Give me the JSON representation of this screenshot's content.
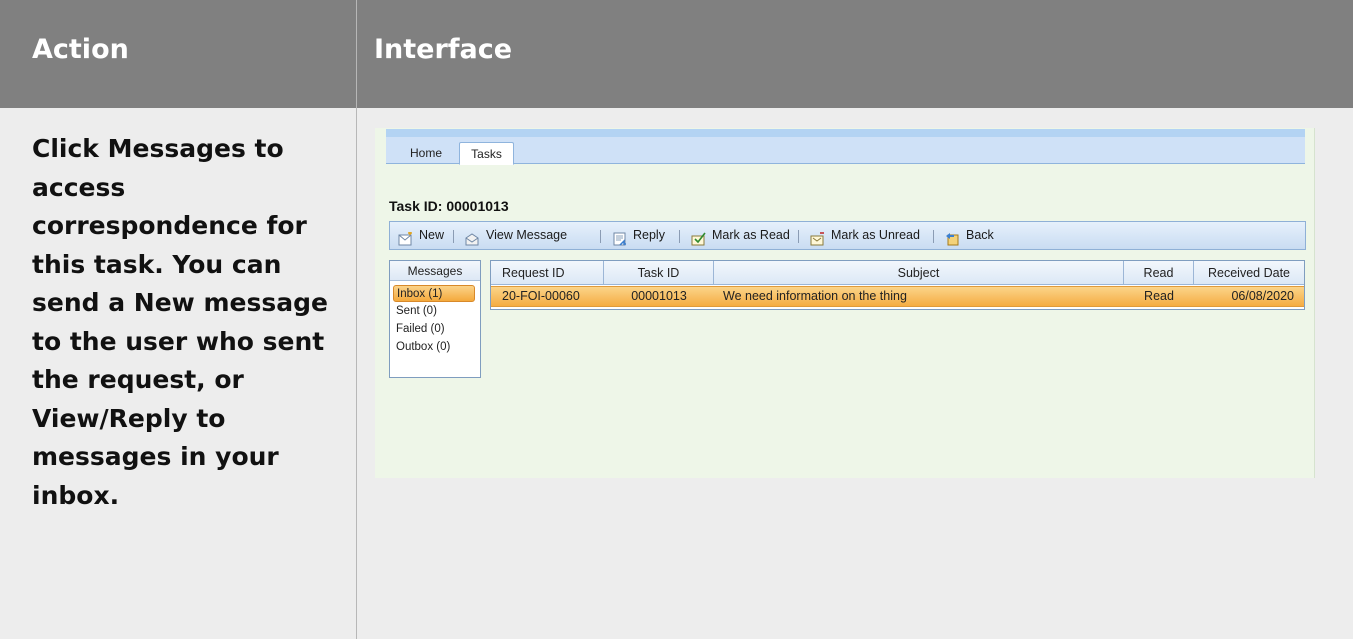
{
  "header": {
    "action": "Action",
    "interface": "Interface"
  },
  "instruction": "Click Messages to access correspondence for this task. You can send a New message to the user who sent the request, or View/Reply to messages in your inbox.",
  "app": {
    "tabs": [
      {
        "label": "Home"
      },
      {
        "label": "Tasks"
      }
    ],
    "active_tab": "Tasks",
    "task_title": "Task ID: 00001013",
    "toolbar": [
      {
        "label": "New",
        "icon": "new-message-icon"
      },
      {
        "label": "View Message",
        "icon": "view-message-icon"
      },
      {
        "label": "Reply",
        "icon": "reply-icon"
      },
      {
        "label": "Mark as Read",
        "icon": "mark-read-icon"
      },
      {
        "label": "Mark as Unread",
        "icon": "mark-unread-icon"
      },
      {
        "label": "Back",
        "icon": "back-icon"
      }
    ],
    "messages_panel": {
      "title": "Messages",
      "items": [
        {
          "label": "Inbox (1)"
        },
        {
          "label": "Sent (0)"
        },
        {
          "label": "Failed (0)"
        },
        {
          "label": "Outbox (0)"
        }
      ],
      "selected": "Inbox (1)"
    },
    "grid": {
      "columns": [
        "Request ID",
        "Task ID",
        "Subject",
        "Read",
        "Received Date"
      ],
      "rows": [
        {
          "request_id": "20-FOI-00060",
          "task_id": "00001013",
          "subject": "We need information on the thing",
          "read": "Read",
          "received_date": "06/08/2020"
        }
      ]
    }
  },
  "colors": {
    "header_bg": "#808080",
    "selection": "#f5ad43",
    "panel_bg": "#eef6e8"
  }
}
